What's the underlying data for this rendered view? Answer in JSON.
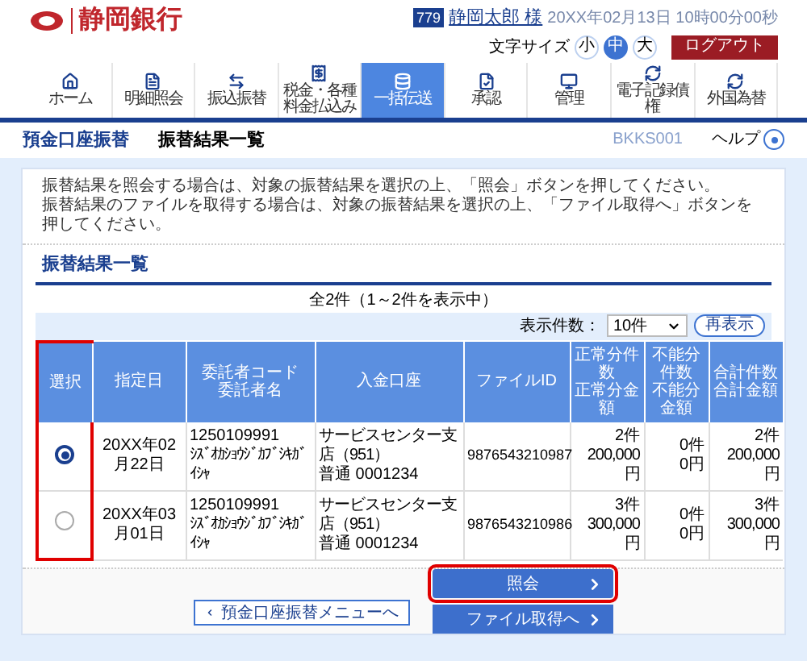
{
  "header": {
    "bank_name": "静岡銀行",
    "user_badge": "779",
    "user_name": "静岡太郎 様",
    "datetime": "20XX年02月13日 10時00分00秒",
    "font_size_label": "文字サイズ",
    "font_sizes": [
      {
        "label": "小",
        "selected": false
      },
      {
        "label": "中",
        "selected": true
      },
      {
        "label": "大",
        "selected": false
      }
    ],
    "logout": "ログアウト"
  },
  "nav": [
    {
      "label": "ホーム",
      "selected": false
    },
    {
      "label": "明細照会",
      "selected": false
    },
    {
      "label": "振込振替",
      "selected": false
    },
    {
      "label": "税金・各種料金払込み",
      "selected": false
    },
    {
      "label": "一括伝送",
      "selected": true
    },
    {
      "label": "承認",
      "selected": false
    },
    {
      "label": "管理",
      "selected": false
    },
    {
      "label": "電子記録債権",
      "selected": false
    },
    {
      "label": "外国為替",
      "selected": false
    }
  ],
  "breadcrumb": {
    "parent": "預金口座振替",
    "current": "振替結果一覧",
    "screen_id": "BKKS001",
    "help": "ヘルプ"
  },
  "instructions": [
    "振替結果を照会する場合は、対象の振替結果を選択の上、「照会」ボタンを押してください。",
    "振替結果のファイルを取得する場合は、対象の振替結果を選択の上、「ファイル取得へ」ボタンを押してください。"
  ],
  "section_title": "振替結果一覧",
  "count_text": "全2件（1～2件を表示中）",
  "page_size": {
    "label": "表示件数：",
    "value": "10件"
  },
  "redisplay": "再表示",
  "table": {
    "columns": [
      {
        "lines": [
          "選択"
        ],
        "highlighted": true
      },
      {
        "lines": [
          "指定日"
        ],
        "highlighted": false
      },
      {
        "lines": [
          "委託者コード",
          "委託者名"
        ],
        "highlighted": false
      },
      {
        "lines": [
          "入金口座"
        ],
        "highlighted": false
      },
      {
        "lines": [
          "ファイルID"
        ],
        "highlighted": false
      },
      {
        "lines": [
          "正常分件数",
          "正常分金額"
        ],
        "highlighted": false
      },
      {
        "lines": [
          "不能分件数",
          "不能分金額"
        ],
        "highlighted": false
      },
      {
        "lines": [
          "合計件数",
          "合計金額"
        ],
        "highlighted": false
      }
    ],
    "rows": [
      {
        "selected": true,
        "date": "20XX年02月22日",
        "code": "1250109991",
        "name": "ｼｽﾞｵｶｼｮｳｼﾞｶﾌﾞｼｷｶﾞｲｼｬ",
        "branch": "サービスセンター支店（951）",
        "account": "普通 0001234",
        "file_id": "9876543210987",
        "normal_count": "2件",
        "normal_amount": "200,000円",
        "fail_count": "0件",
        "fail_amount": "0円",
        "total_count": "2件",
        "total_amount": "200,000円"
      },
      {
        "selected": false,
        "date": "20XX年03月01日",
        "code": "1250109991",
        "name": "ｼｽﾞｵｶｼｮｳｼﾞｶﾌﾞｼｷｶﾞｲｼｬ",
        "branch": "サービスセンター支店（951）",
        "account": "普通 0001234",
        "file_id": "9876543210986",
        "normal_count": "3件",
        "normal_amount": "300,000円",
        "fail_count": "0件",
        "fail_amount": "0円",
        "total_count": "3件",
        "total_amount": "300,000円"
      }
    ]
  },
  "buttons": {
    "back": {
      "label": "預金口座振替メニューへ"
    },
    "inquiry": {
      "label": "照会",
      "highlighted": true
    },
    "file": {
      "label": "ファイル取得へ"
    }
  }
}
